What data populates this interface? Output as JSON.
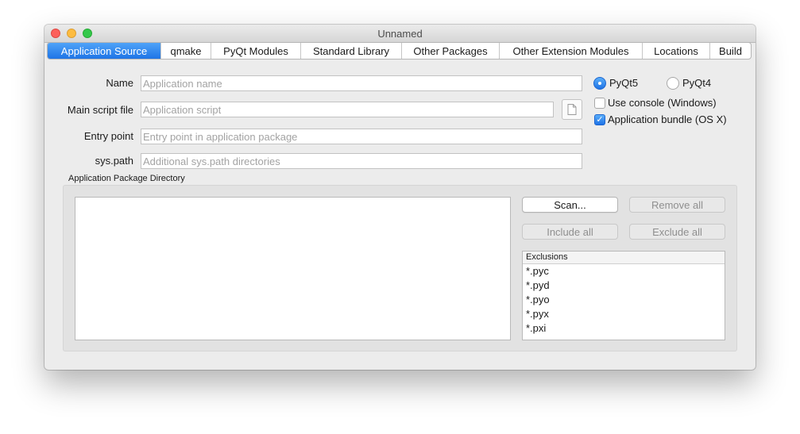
{
  "window": {
    "title": "Unnamed"
  },
  "tabs": [
    {
      "label": "Application Source",
      "active": true
    },
    {
      "label": "qmake",
      "active": false
    },
    {
      "label": "PyQt Modules",
      "active": false
    },
    {
      "label": "Standard Library",
      "active": false
    },
    {
      "label": "Other Packages",
      "active": false
    },
    {
      "label": "Other Extension Modules",
      "active": false
    },
    {
      "label": "Locations",
      "active": false
    },
    {
      "label": "Build",
      "active": false
    }
  ],
  "form": {
    "name": {
      "label": "Name",
      "value": "",
      "placeholder": "Application name"
    },
    "main_script": {
      "label": "Main script file",
      "value": "",
      "placeholder": "Application script"
    },
    "entry_point": {
      "label": "Entry point",
      "value": "",
      "placeholder": "Entry point in application package"
    },
    "sys_path": {
      "label": "sys.path",
      "value": "",
      "placeholder": "Additional sys.path directories"
    }
  },
  "options": {
    "pyqt5": {
      "label": "PyQt5",
      "selected": true
    },
    "pyqt4": {
      "label": "PyQt4",
      "selected": false
    },
    "use_console": {
      "label": "Use console (Windows)",
      "checked": false
    },
    "app_bundle": {
      "label": "Application bundle (OS X)",
      "checked": true
    }
  },
  "package": {
    "title": "Application Package Directory",
    "buttons": {
      "scan": "Scan...",
      "remove_all": "Remove all",
      "include_all": "Include all",
      "exclude_all": "Exclude all"
    },
    "exclusions": {
      "header": "Exclusions",
      "items": [
        "*.pyc",
        "*.pyd",
        "*.pyo",
        "*.pyx",
        "*.pxi"
      ]
    }
  },
  "colors": {
    "accent": "#1e74e6",
    "window_bg": "#ececec"
  }
}
